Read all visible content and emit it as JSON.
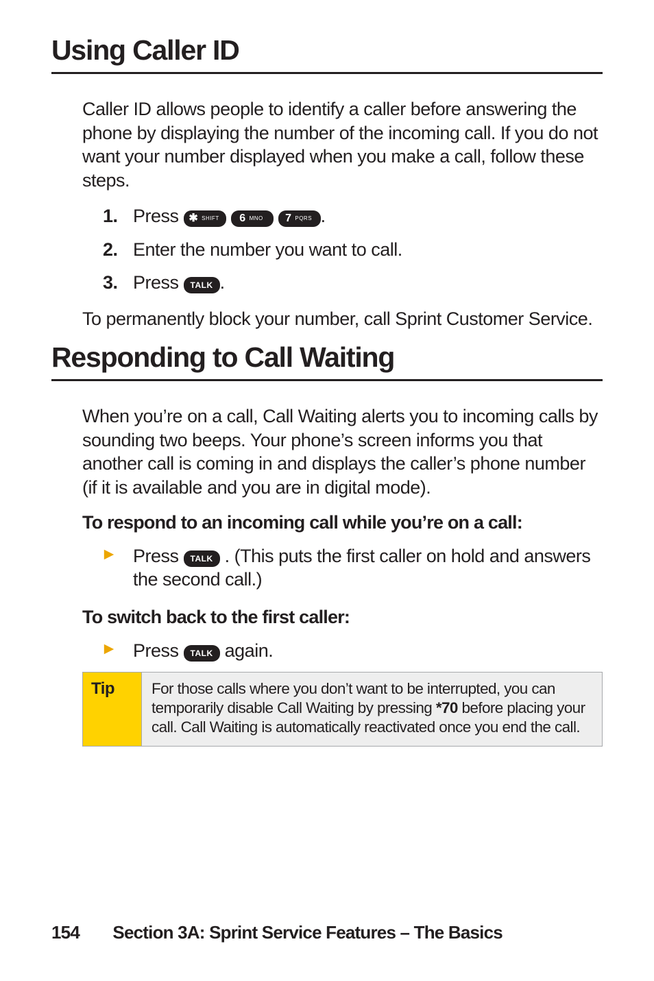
{
  "heading1": "Using Caller ID",
  "intro1": "Caller ID allows people to identify a caller before answering the phone by displaying the number of the incoming call. If you do not want your number displayed when you make a call, follow these steps.",
  "steps": [
    {
      "num": "1.",
      "pre": "Press ",
      "post": "."
    },
    {
      "num": "2.",
      "text": "Enter the number you want to call."
    },
    {
      "num": "3.",
      "pre": "Press ",
      "post": "."
    }
  ],
  "keys": {
    "star_sym": "✱",
    "star_sub": "SHIFT",
    "six_sym": "6",
    "six_sub": "MNO",
    "seven_sym": "7",
    "seven_sub": "PQRS",
    "talk": "TALK"
  },
  "outro1": "To permanently block your number, call Sprint Customer Service.",
  "heading2": "Responding to Call Waiting",
  "intro2": "When you’re on a call, Call Waiting alerts you to incoming calls by sounding two beeps. Your phone’s screen informs you that another call is coming in and displays the caller’s phone number (if it is available and you are in digital mode).",
  "sub1": "To respond to an incoming call while you’re on a call:",
  "bullet1": {
    "pre": "Press  ",
    "post": " . (This puts the first caller on hold and answers the second call.)"
  },
  "sub2": "To switch back to the first caller:",
  "bullet2": {
    "pre": "Press ",
    "post": " again."
  },
  "tip": {
    "label": "Tip",
    "text_pre": "For those calls where you don’t want to be interrupted, you can temporarily disable Call Waiting by pressing ",
    "code": "*70",
    "text_post": " before placing your call. Call Waiting is automatically reactivated once you end the call."
  },
  "footer": {
    "page": "154",
    "section": "Section 3A: Sprint Service Features – The Basics"
  },
  "colors": {
    "accent": "#eca600"
  }
}
